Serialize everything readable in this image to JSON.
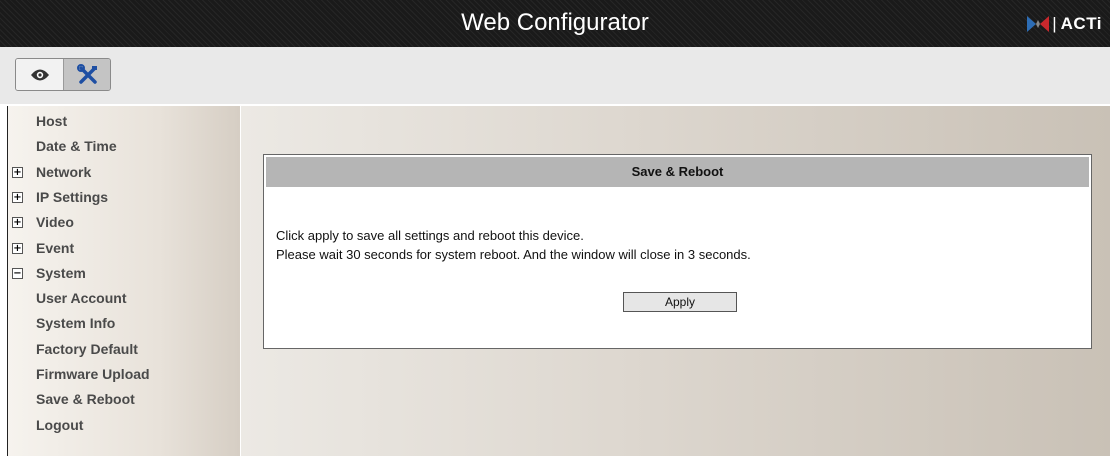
{
  "header": {
    "title": "Web Configurator",
    "logo_text": "ACTi",
    "logo_separator": "|"
  },
  "toolbar": {
    "view_icon": "eye-icon",
    "config_icon": "tools-icon"
  },
  "sidebar": {
    "items": [
      {
        "label": "Host",
        "toggle": ""
      },
      {
        "label": "Date & Time",
        "toggle": ""
      },
      {
        "label": "Network",
        "toggle": "+"
      },
      {
        "label": "IP Settings",
        "toggle": "+"
      },
      {
        "label": "Video",
        "toggle": "+"
      },
      {
        "label": "Event",
        "toggle": "+"
      },
      {
        "label": "System",
        "toggle": "−"
      },
      {
        "label": "User Account",
        "toggle": ""
      },
      {
        "label": "System Info",
        "toggle": ""
      },
      {
        "label": "Factory Default",
        "toggle": ""
      },
      {
        "label": "Firmware Upload",
        "toggle": ""
      },
      {
        "label": "Save & Reboot",
        "toggle": ""
      },
      {
        "label": "Logout",
        "toggle": ""
      }
    ]
  },
  "panel": {
    "title": "Save & Reboot",
    "line1": "Click apply to save all settings and reboot this device.",
    "line2": "Please wait 30 seconds for system reboot. And the window will close in 3 seconds.",
    "apply_label": "Apply"
  },
  "colors": {
    "titlebar": "#1a1a1a",
    "panel_header": "#b5b5b5",
    "logo_blue": "#2d6db5",
    "logo_red": "#c8282d"
  }
}
